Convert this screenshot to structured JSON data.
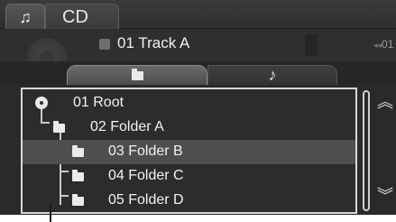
{
  "source_tabs": {
    "music_icon": "music-note-icon",
    "cd_label": "CD"
  },
  "now_playing": {
    "track_title": "01  Track A",
    "time_fragment": "01"
  },
  "view_tabs": {
    "folder_icon": "folder-icon",
    "track_icon": "music-note-icon",
    "track_glyph": "♪",
    "active": "folder"
  },
  "folder_list": {
    "rows": [
      {
        "label": "01 Root",
        "icon": "disc-icon",
        "selected": false
      },
      {
        "label": "02 Folder A",
        "icon": "folder-icon",
        "selected": false
      },
      {
        "label": "03 Folder B",
        "icon": "folder-icon",
        "selected": true
      },
      {
        "label": "04 Folder C",
        "icon": "folder-icon",
        "selected": false
      },
      {
        "label": "05 Folder D",
        "icon": "folder-icon",
        "selected": false
      }
    ]
  },
  "scroll": {
    "up_glyph": "︽",
    "down_glyph": "︾"
  }
}
